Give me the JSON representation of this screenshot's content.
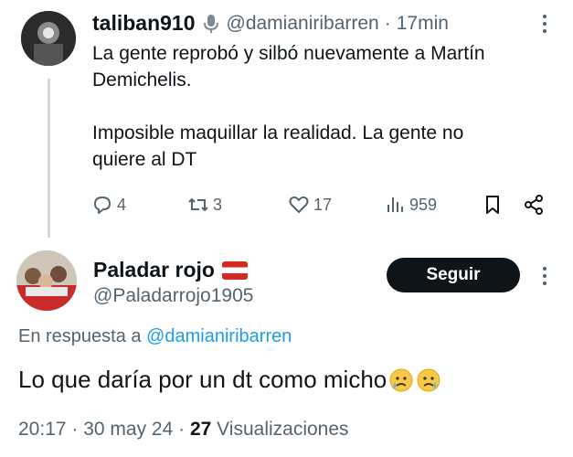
{
  "tweet1": {
    "name": "taliban910",
    "handle": "@damianiribarren",
    "separator": "·",
    "time": "17min",
    "text": "La gente reprobó y silbó nuevamente a Martín\nDemichelis.\n\nImposible maquillar la realidad. La gente no\nquiere al DT",
    "actions": {
      "replies": "4",
      "retweets": "3",
      "likes": "17",
      "views": "959"
    }
  },
  "tweet2": {
    "name": "Paladar rojo",
    "handle": "@Paladarrojo1905",
    "follow_label": "Seguir",
    "reply_prefix": "En respuesta a",
    "reply_to": "@damianiribarren",
    "text": "Lo que daría por un dt como micho",
    "time": "20:17",
    "date": "30 may 24",
    "views_count": "27",
    "views_label": "Visualizaciones"
  },
  "colors": {
    "accent": "#1d9bf0",
    "muted": "#536471",
    "text": "#0f1419",
    "button_bg": "#0f1419"
  },
  "icons": [
    "microphone-icon",
    "more-icon",
    "reply-icon",
    "retweet-icon",
    "like-icon",
    "views-icon",
    "bookmark-icon",
    "share-icon",
    "flag-icon",
    "sad-emoji-icon"
  ]
}
